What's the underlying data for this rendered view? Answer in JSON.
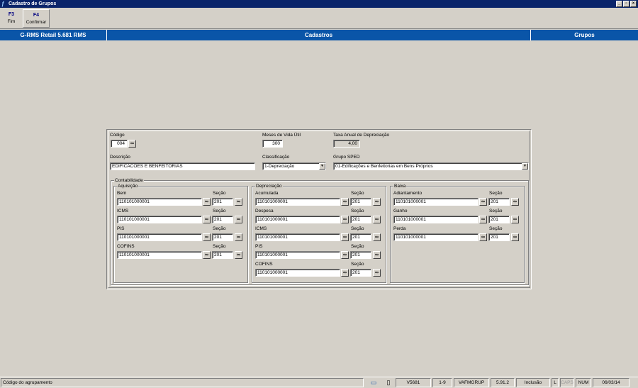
{
  "window": {
    "title": "Cadastro de Grupos"
  },
  "toolbar": {
    "buttons": [
      {
        "key": "F3",
        "label": "Fim"
      },
      {
        "key": "F4",
        "label": "Confirmar"
      }
    ]
  },
  "header": {
    "left": "G-RMS Retail 5.681 RMS",
    "center": "Cadastros",
    "right": "Grupos"
  },
  "form": {
    "codigo": {
      "label": "Código",
      "value": "004"
    },
    "meses": {
      "label": "Meses de Vida Útil",
      "value": "300"
    },
    "taxa": {
      "label": "Taxa Anual de Depreciação",
      "value": "4,00"
    },
    "descricao": {
      "label": "Descrição",
      "value": "EDIFICACOES E BENFEITORIAS"
    },
    "classificacao": {
      "label": "Classificação",
      "value": "1-Depreciação"
    },
    "grupo_sped": {
      "label": "Grupo SPED",
      "value": "01-Edificações e Benfeitorias em Bens Próprios"
    },
    "contabilidade": {
      "title": "Contabilidade",
      "aquisicao": {
        "title": "Aquisição",
        "rows": [
          {
            "label": "Bem",
            "conta": "110101000001",
            "secao_label": "Seção",
            "secao": "201"
          },
          {
            "label": "ICMS",
            "conta": "110101000001",
            "secao_label": "Seção",
            "secao": "201"
          },
          {
            "label": "PIS",
            "conta": "110101000001",
            "secao_label": "Seção",
            "secao": "201"
          },
          {
            "label": "COFINS",
            "conta": "110101000001",
            "secao_label": "Seção",
            "secao": "201"
          }
        ]
      },
      "depreciacao": {
        "title": "Depreciação",
        "rows": [
          {
            "label": "Acumulada",
            "conta": "110101000001",
            "secao_label": "Seção",
            "secao": "201"
          },
          {
            "label": "Despesa",
            "conta": "110101000001",
            "secao_label": "Seção",
            "secao": "201"
          },
          {
            "label": "ICMS",
            "conta": "110101000001",
            "secao_label": "Seção",
            "secao": "201"
          },
          {
            "label": "PIS",
            "conta": "110101000001",
            "secao_label": "Seção",
            "secao": "201"
          },
          {
            "label": "COFINS",
            "conta": "110101000001",
            "secao_label": "Seção",
            "secao": "201"
          }
        ]
      },
      "baixa": {
        "title": "Baixa",
        "rows": [
          {
            "label": "Adiantamento",
            "conta": "110101000001",
            "secao_label": "Seção",
            "secao": "201"
          },
          {
            "label": "Ganho",
            "conta": "110101000001",
            "secao_label": "Seção",
            "secao": "201"
          },
          {
            "label": "Perda",
            "conta": "110101000001",
            "secao_label": "Seção",
            "secao": "201"
          }
        ]
      }
    }
  },
  "status": {
    "message": "Código do agrupamento",
    "version": "V5681",
    "range": "1-9",
    "program": "VAFMGRUP",
    "release": "5.91.2",
    "mode": "Inclusão",
    "l": "L",
    "caps": "CAPS",
    "num": "NUM",
    "date": "06/03/14"
  },
  "icons": {
    "binoculars": "binoculars-icon",
    "dropdown": "chevron-down-icon"
  }
}
